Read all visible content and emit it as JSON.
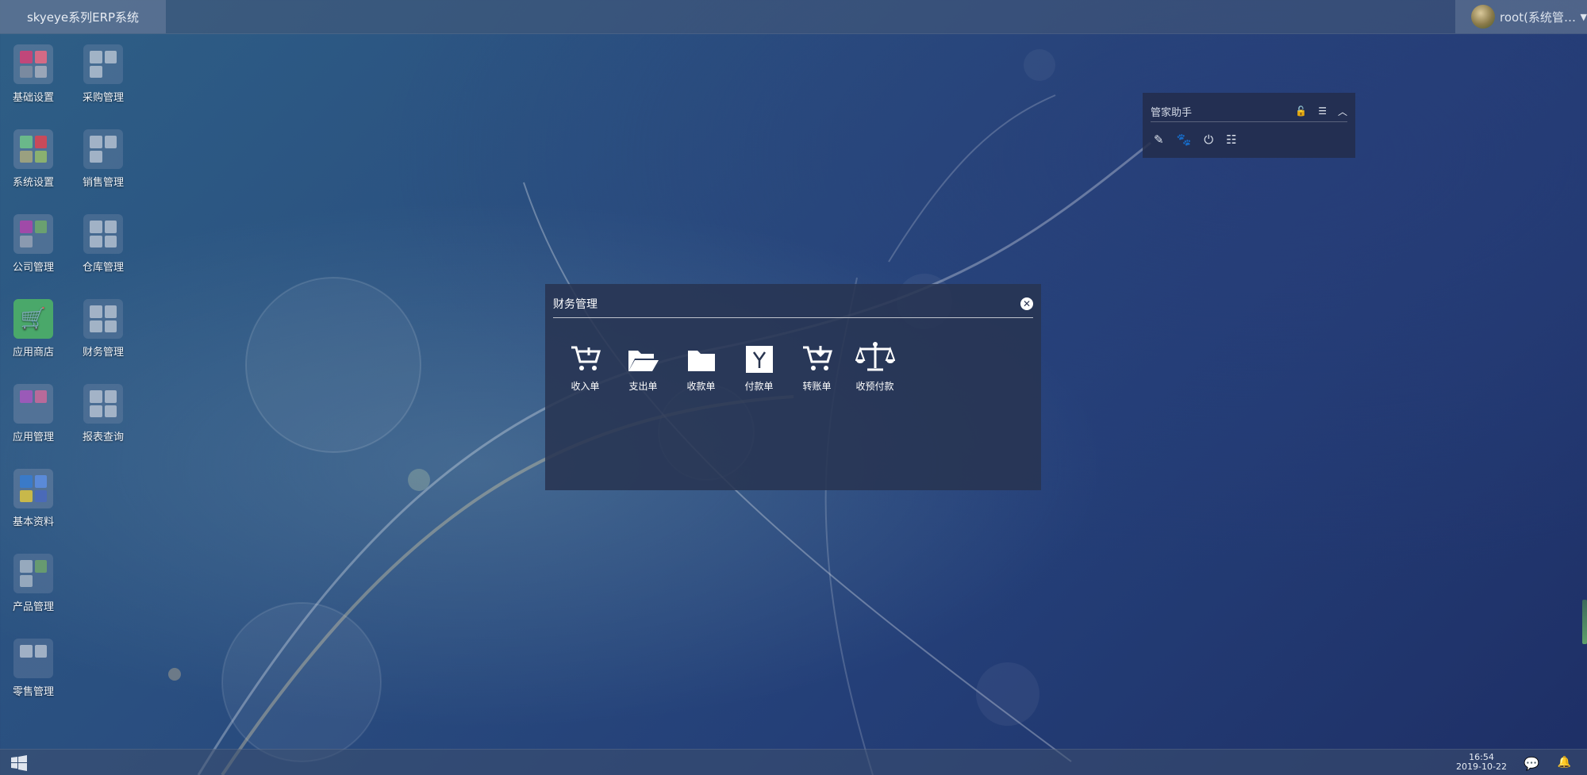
{
  "topbar": {
    "app_title": "skyeye系列ERP系统",
    "user_label": "root(系统管理员)"
  },
  "desktop_icons": [
    {
      "label": "基础设置",
      "icon": "grid-settings-icon"
    },
    {
      "label": "采购管理",
      "icon": "purchase-icon"
    },
    {
      "label": "系统设置",
      "icon": "system-settings-icon"
    },
    {
      "label": "销售管理",
      "icon": "sales-icon"
    },
    {
      "label": "公司管理",
      "icon": "company-icon"
    },
    {
      "label": "仓库管理",
      "icon": "warehouse-icon"
    },
    {
      "label": "应用商店",
      "icon": "app-store-icon"
    },
    {
      "label": "财务管理",
      "icon": "finance-icon"
    },
    {
      "label": "应用管理",
      "icon": "app-manage-icon"
    },
    {
      "label": "报表查询",
      "icon": "report-icon"
    },
    {
      "label": "基本资料",
      "icon": "basic-data-icon"
    },
    {
      "label": "产品管理",
      "icon": "product-icon"
    },
    {
      "label": "零售管理",
      "icon": "retail-icon"
    }
  ],
  "assistant": {
    "title": "管家助手",
    "controls": [
      "lock-icon",
      "menu-icon",
      "collapse-icon"
    ],
    "tools": [
      "edit-icon",
      "paw-icon",
      "power-icon",
      "list-icon"
    ]
  },
  "finance_dialog": {
    "title": "财务管理",
    "apps": [
      {
        "label": "收入单",
        "icon": "cart-plus-icon"
      },
      {
        "label": "支出单",
        "icon": "folder-open-icon"
      },
      {
        "label": "收款单",
        "icon": "folder-icon"
      },
      {
        "label": "付款单",
        "icon": "yen-box-icon"
      },
      {
        "label": "转账单",
        "icon": "cart-download-icon"
      },
      {
        "label": "收预付款",
        "icon": "balance-scale-icon"
      }
    ]
  },
  "taskbar": {
    "time": "16:54",
    "date": "2019-10-22"
  },
  "colors": {
    "accent_store": "#4aa86a",
    "dialog_bg": "#28344f"
  }
}
